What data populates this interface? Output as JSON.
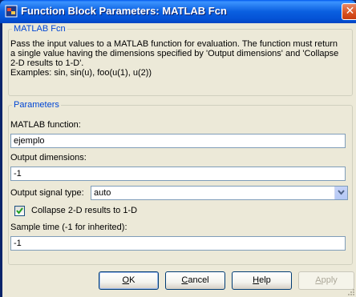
{
  "window": {
    "title": "Function Block Parameters: MATLAB Fcn",
    "close_glyph": "✕"
  },
  "block_group": {
    "legend": "MATLAB Fcn",
    "description_lines": [
      "Pass the input values to a MATLAB function for evaluation.  The function must return",
      "a single value having the dimensions specified by 'Output dimensions' and 'Collapse",
      "2-D results to 1-D'.",
      "Examples: sin, sin(u), foo(u(1), u(2))"
    ]
  },
  "parameters": {
    "legend": "Parameters",
    "matlab_function": {
      "label": "MATLAB function:",
      "value": "ejemplo"
    },
    "output_dimensions": {
      "label": "Output dimensions:",
      "value": "-1"
    },
    "output_signal_type": {
      "label": "Output signal type:",
      "value": "auto"
    },
    "collapse": {
      "label": "Collapse 2-D results to 1-D",
      "checked": true
    },
    "sample_time": {
      "label": "Sample time (-1 for inherited):",
      "value": "-1"
    }
  },
  "buttons": {
    "ok": {
      "label": "OK",
      "mnemonic_index": 0
    },
    "cancel": {
      "label": "Cancel",
      "mnemonic_index": 0
    },
    "help": {
      "label": "Help",
      "mnemonic_index": 0
    },
    "apply": {
      "label": "Apply",
      "mnemonic_index": 0,
      "enabled": false
    }
  },
  "icons": {
    "app": "simulink-block-icon",
    "close": "close-icon",
    "dropdown": "chevron-down-icon",
    "check": "checkmark-icon",
    "grip": "resize-grip-icon"
  },
  "colors": {
    "title_bar": "#0a5fe0",
    "group_legend": "#0046d5",
    "dialog_bg": "#ece9d8",
    "close_button": "#d8501f"
  }
}
